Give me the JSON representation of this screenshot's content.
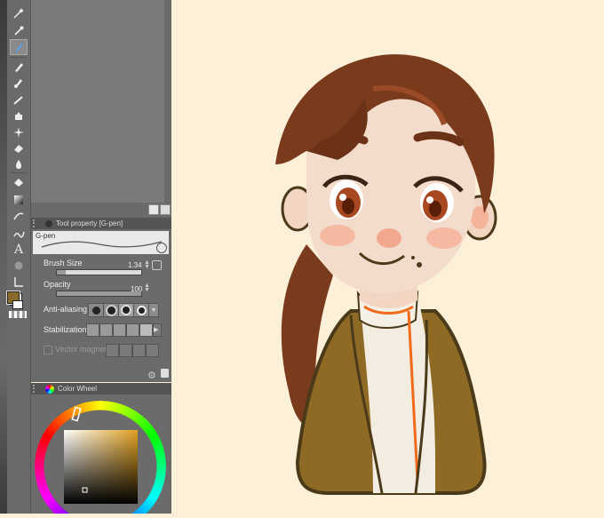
{
  "tool_property": {
    "header": "Tool property [G-pen]",
    "brush_name": "G-pen",
    "brush_size_label": "Brush Size",
    "brush_size_value": "1.34",
    "brush_size_fraction": 0.1,
    "opacity_label": "Opacity",
    "opacity_value": "100",
    "opacity_fraction": 1.0,
    "anti_aliasing_label": "Anti-aliasing",
    "stabilization_label": "Stabilization",
    "vector_magnet_label": "Vector magnet"
  },
  "color_wheel": {
    "header": "Color Wheel",
    "selected_color": "#e0a040"
  },
  "colors": {
    "main": "#8a6a2a",
    "sub": "#ffffff",
    "canvas_bg": "#fdf0d8"
  },
  "toolbar_icons": [
    "wand-icon",
    "eyedropper-icon",
    "pen-icon",
    "pen-icon",
    "brush-icon",
    "airbrush-icon",
    "decoration-icon",
    "eraser-icon",
    "fill-icon",
    "blend-icon",
    "gradient-icon",
    "figure-icon",
    "line-icon",
    "text-icon",
    "circle-icon",
    "ruler-icon"
  ]
}
